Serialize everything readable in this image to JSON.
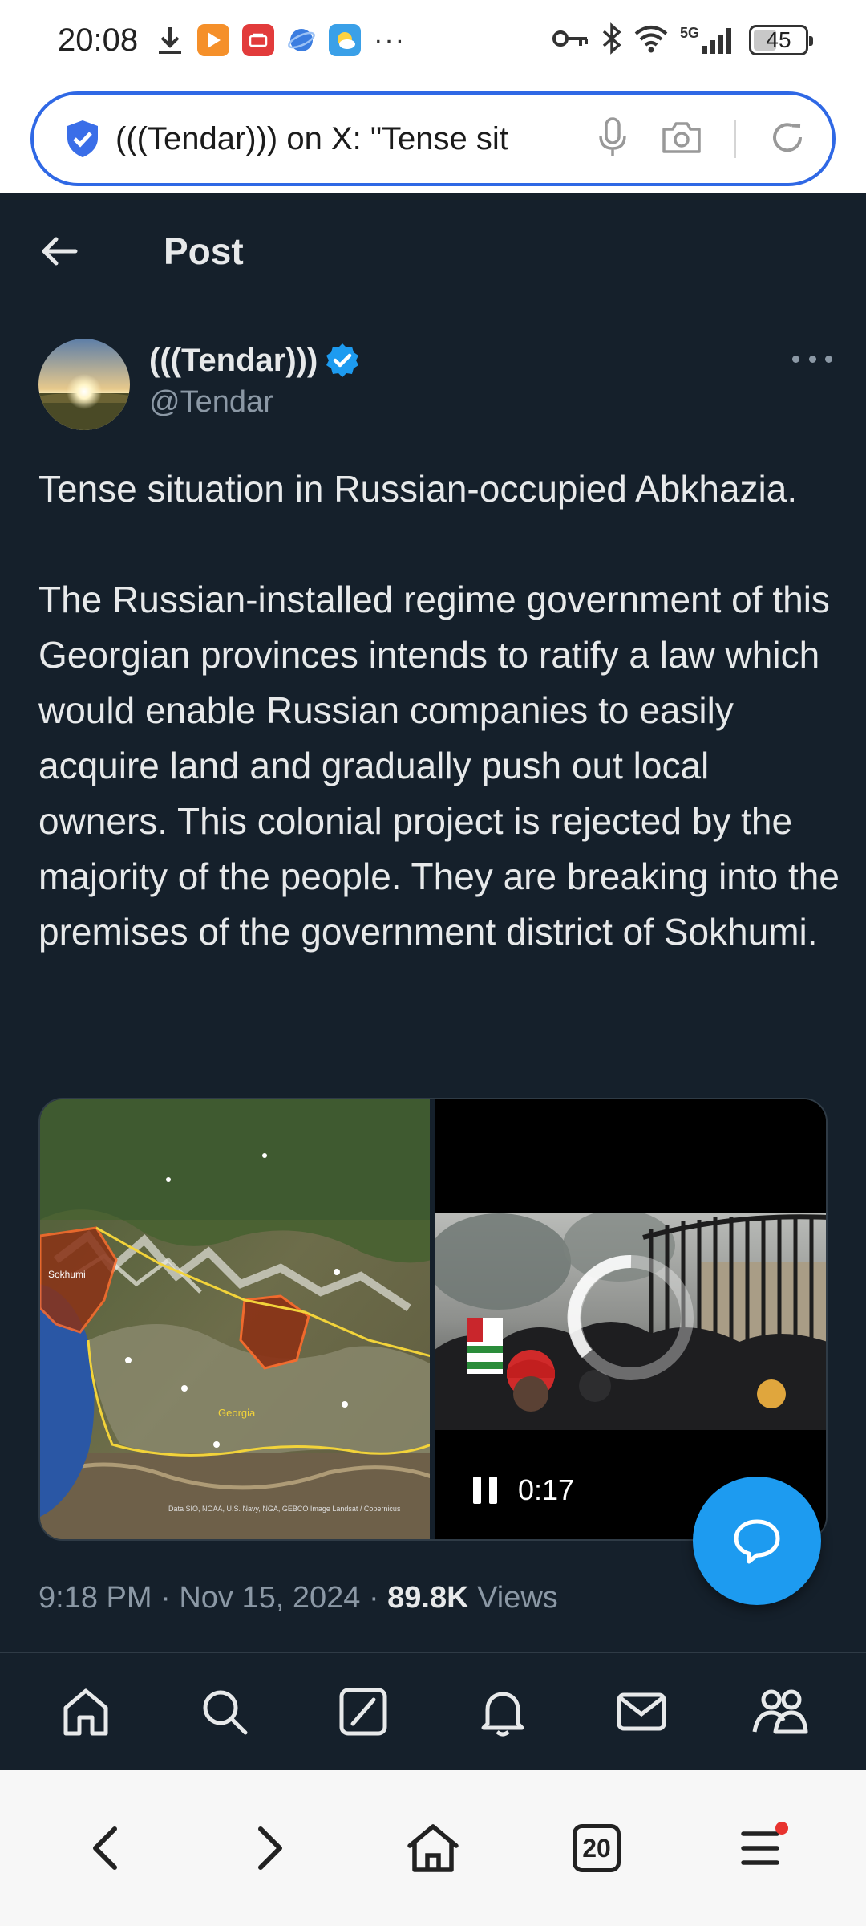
{
  "status_bar": {
    "time": "20:08",
    "network": "5G",
    "battery": "45",
    "battery_level": 0.45,
    "overflow": "···",
    "icons": [
      "download-icon",
      "video-app-icon",
      "huawei-app-icon",
      "browser-app-icon",
      "weather-app-icon",
      "key-icon",
      "bluetooth-icon",
      "wifi-icon",
      "signal-icon"
    ]
  },
  "browser": {
    "address_text": "(((Tendar))) on X: \"Tense sit",
    "tabs_count": "20"
  },
  "header": {
    "title": "Post"
  },
  "author": {
    "name": "(((Tendar)))",
    "handle": "@Tendar",
    "verified": true
  },
  "post": {
    "paragraph1": "Tense situation in Russian-occupied Abkhazia.",
    "paragraph2": "The Russian-installed regime government of this Georgian provinces intends to ratify a law which would enable Russian companies to easily acquire land and gradually push out local owners. This colonial project is rejected by the majority of the people. They are breaking into the premises of the government district of Sokhumi.",
    "time": "9:18 PM",
    "date": "Nov 15, 2024",
    "separator": "·",
    "views_count": "89.8K",
    "views_label": "Views"
  },
  "media": {
    "map_label_region": "Georgia",
    "map_label_city": "Sokhumi",
    "map_credit": "Data SIO, NOAA, U.S. Navy, NGA, GEBCO Image Landsat / Copernicus",
    "video_time": "0:17"
  },
  "colors": {
    "background": "#15202b",
    "accent": "#1d9bf0",
    "text": "#e7e9ea",
    "muted": "#8b98a5",
    "address_border": "#2f68e5"
  }
}
